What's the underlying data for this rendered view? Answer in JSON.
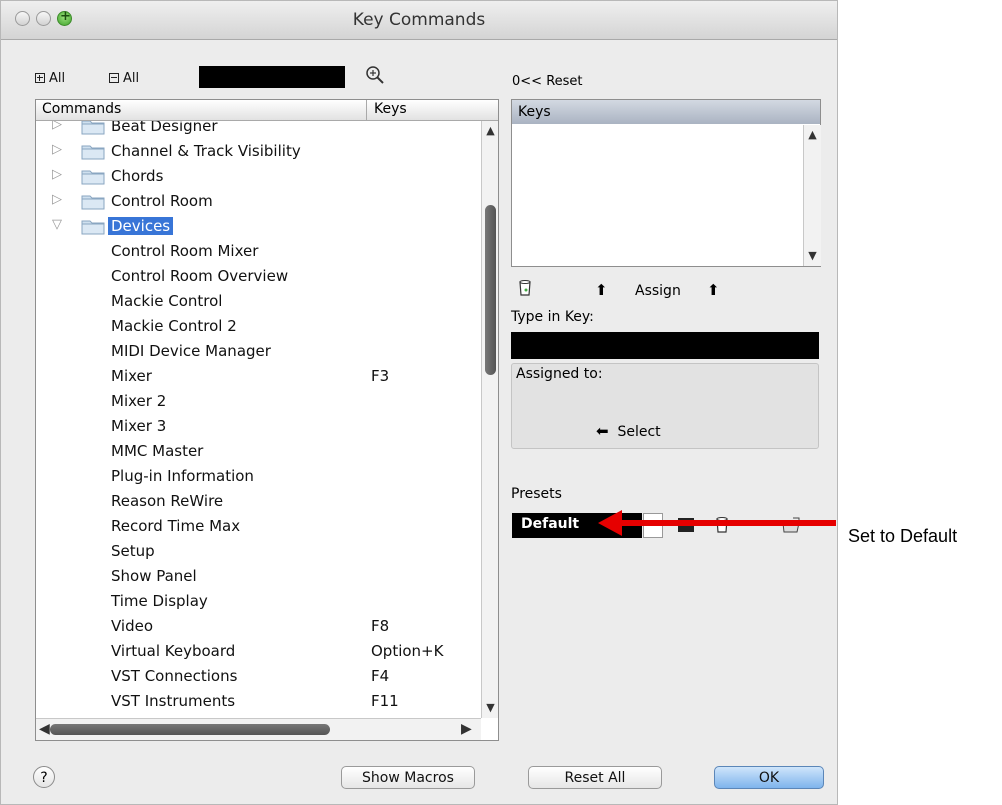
{
  "window": {
    "title": "Key Commands"
  },
  "toolbar": {
    "expand_all": "All",
    "collapse_all": "All",
    "search_value": ""
  },
  "commands": {
    "col_commands": "Commands",
    "col_keys": "Keys",
    "rows": [
      {
        "label": "Beat Designer",
        "key": "",
        "type": "folder",
        "expanded": false
      },
      {
        "label": "Channel & Track Visibility",
        "key": "",
        "type": "folder",
        "expanded": false
      },
      {
        "label": "Chords",
        "key": "",
        "type": "folder",
        "expanded": false
      },
      {
        "label": "Control Room",
        "key": "",
        "type": "folder",
        "expanded": false
      },
      {
        "label": "Devices",
        "key": "",
        "type": "folder",
        "expanded": true,
        "selected": true
      },
      {
        "label": "Control Room Mixer",
        "key": "",
        "type": "item"
      },
      {
        "label": "Control Room Overview",
        "key": "",
        "type": "item"
      },
      {
        "label": "Mackie Control",
        "key": "",
        "type": "item"
      },
      {
        "label": "Mackie Control 2",
        "key": "",
        "type": "item"
      },
      {
        "label": "MIDI Device Manager",
        "key": "",
        "type": "item"
      },
      {
        "label": "Mixer",
        "key": "F3",
        "type": "item"
      },
      {
        "label": "Mixer 2",
        "key": "",
        "type": "item"
      },
      {
        "label": "Mixer 3",
        "key": "",
        "type": "item"
      },
      {
        "label": "MMC Master",
        "key": "",
        "type": "item"
      },
      {
        "label": "Plug-in Information",
        "key": "",
        "type": "item"
      },
      {
        "label": "Reason ReWire",
        "key": "",
        "type": "item"
      },
      {
        "label": "Record Time Max",
        "key": "",
        "type": "item"
      },
      {
        "label": "Setup",
        "key": "",
        "type": "item"
      },
      {
        "label": "Show Panel",
        "key": "",
        "type": "item"
      },
      {
        "label": "Time Display",
        "key": "",
        "type": "item"
      },
      {
        "label": "Video",
        "key": "F8",
        "type": "item"
      },
      {
        "label": "Virtual Keyboard",
        "key": "Option+K",
        "type": "item"
      },
      {
        "label": "VST Connections",
        "key": "F4",
        "type": "item"
      },
      {
        "label": "VST Instruments",
        "key": "F11",
        "type": "item"
      }
    ]
  },
  "right": {
    "reset": "0<< Reset",
    "keys_header": "Keys",
    "assign": "Assign",
    "type_in_key": "Type in Key:",
    "assigned_to": "Assigned to:",
    "select": "Select",
    "presets_label": "Presets",
    "preset_value": "Default"
  },
  "annotation": {
    "text": "Set to Default",
    "color": "#e60000"
  },
  "footer": {
    "help": "?",
    "show_macros": "Show Macros",
    "reset_all": "Reset All",
    "ok": "OK"
  }
}
